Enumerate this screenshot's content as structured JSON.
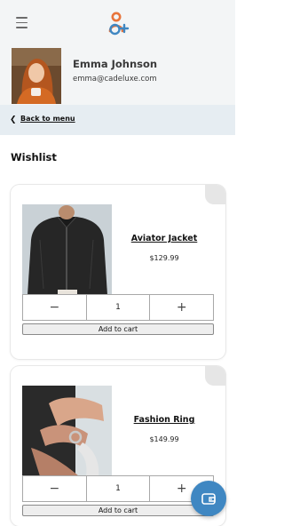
{
  "header": {
    "menu_icon": "hamburger-icon",
    "logo_icon": "user-plus-logo-icon",
    "colors": {
      "logo_orange": "#e8743b",
      "logo_blue": "#3f87c2"
    }
  },
  "profile": {
    "name": "Emma Johnson",
    "email": "emma@cadeluxe.com"
  },
  "nav": {
    "back_icon": "chevron-left-icon",
    "back_label": "Back to menu"
  },
  "wishlist": {
    "title": "Wishlist",
    "items": [
      {
        "name": "Aviator Jacket",
        "price": "$129.99",
        "quantity": "1",
        "add_to_cart_label": "Add to cart"
      },
      {
        "name": "Fashion Ring",
        "price": "$149.99",
        "quantity": "1",
        "add_to_cart_label": "Add to cart"
      }
    ]
  },
  "stepper_labels": {
    "decrement": "−",
    "increment": "+"
  },
  "fab": {
    "icon": "wallet-icon",
    "color": "#3f87c2"
  }
}
